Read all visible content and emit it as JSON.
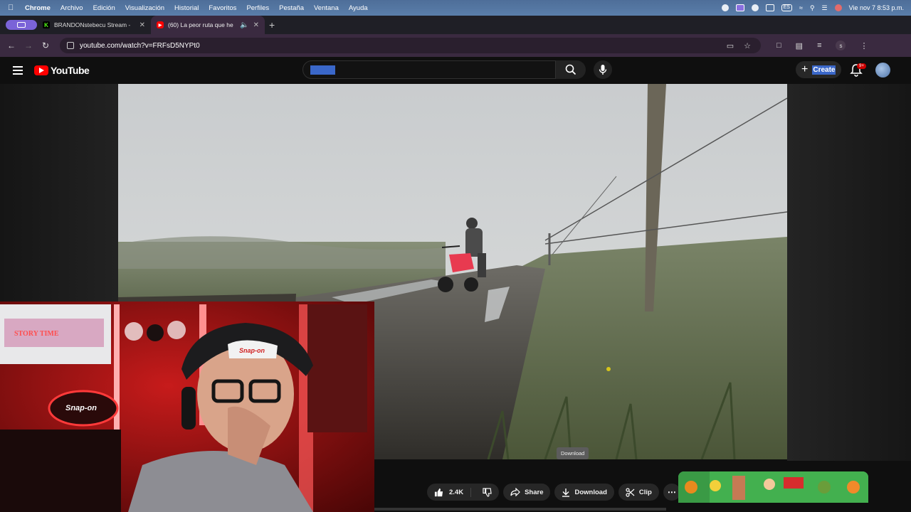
{
  "menubar": {
    "items": [
      "Chrome",
      "Archivo",
      "Edición",
      "Visualización",
      "Historial",
      "Favoritos",
      "Perfiles",
      "Pestaña",
      "Ventana",
      "Ayuda"
    ],
    "input_source": "ES",
    "datetime": "Vie nov 7  8:53 p.m."
  },
  "tabs": [
    {
      "title": "BRANDONstebecu Stream - ",
      "favicon": "K",
      "favicon_color": "#53fc18"
    },
    {
      "title": "(60) La peor ruta que he",
      "favicon": "▶",
      "favicon_color": "#ff0000"
    }
  ],
  "address": {
    "url": "youtube.com/watch?v=FRFsD5NYPt0",
    "profile_initial": "s"
  },
  "youtube": {
    "logo_text": "YouTube",
    "search_value": "",
    "create_label": "Create",
    "notifications_badge": "9+"
  },
  "video": {
    "tooltip": "Download",
    "likes": "2.4K",
    "share_label": "Share",
    "download_label": "Download",
    "clip_label": "Clip",
    "progress": 0.0
  },
  "webcam": {
    "sign_text": "Snap-on",
    "cap_text": "Snap-on",
    "neon_text": "STORY TIME"
  },
  "colors": {
    "yt_red": "#ff0000",
    "accent_blue": "#3a67c9",
    "tab_group": "#7a63d8"
  }
}
